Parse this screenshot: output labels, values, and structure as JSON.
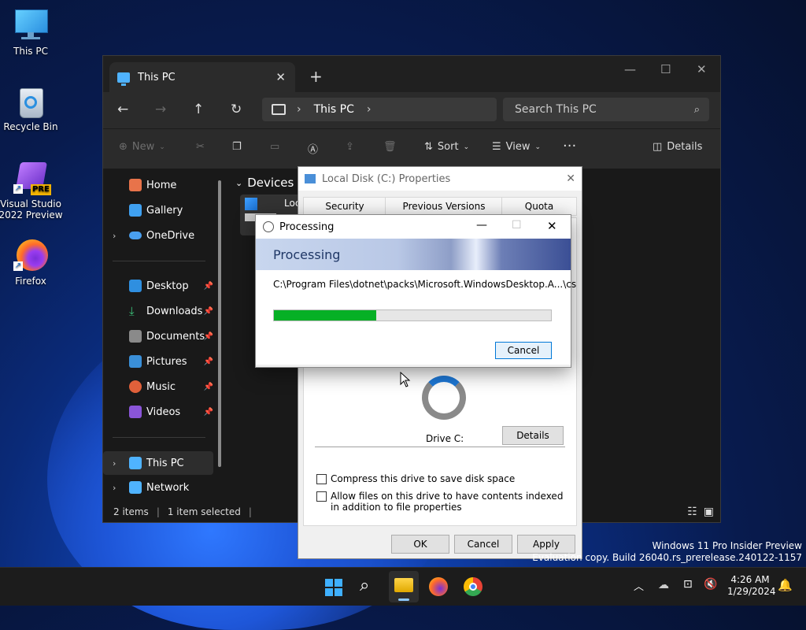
{
  "desktop": {
    "icons": [
      {
        "label": "This PC",
        "icon": "monitor-icon"
      },
      {
        "label": "Recycle Bin",
        "icon": "recycle-bin-icon"
      },
      {
        "label": "Visual Studio 2022 Preview",
        "badge": "PRE",
        "icon": "visual-studio-icon"
      },
      {
        "label": "Firefox",
        "icon": "firefox-icon"
      }
    ]
  },
  "explorer": {
    "tab_title": "This PC",
    "breadcrumb": [
      "This PC"
    ],
    "search_placeholder": "Search This PC",
    "toolbar": {
      "new_label": "New",
      "sort_label": "Sort",
      "view_label": "View",
      "details_label": "Details"
    },
    "sidebar": {
      "items": [
        {
          "label": "Home",
          "color": "#e8734a"
        },
        {
          "label": "Gallery",
          "color": "#3fa0f0"
        },
        {
          "label": "OneDrive",
          "color": "#4aa0f0"
        },
        {
          "label": "Desktop",
          "color": "#2f8fe0"
        },
        {
          "label": "Downloads",
          "color": "#3cc27a"
        },
        {
          "label": "Documents",
          "color": "#8a8a8a"
        },
        {
          "label": "Pictures",
          "color": "#3a8fd8"
        },
        {
          "label": "Music",
          "color": "#e0603a"
        },
        {
          "label": "Videos",
          "color": "#8a55d8"
        },
        {
          "label": "This PC",
          "color": "#4fb3ff"
        },
        {
          "label": "Network",
          "color": "#4fb3ff"
        }
      ]
    },
    "content_heading": "Devices ar",
    "drive_label_fragment": "Loc",
    "status": {
      "items": "2 items",
      "selected": "1 item selected"
    }
  },
  "properties_dialog": {
    "title": "Local Disk (C:) Properties",
    "tabs": [
      "Security",
      "Previous Versions",
      "Quota"
    ],
    "drive_caption": "Drive C:",
    "details_button": "Details",
    "compress_label": "Compress this drive to save disk space",
    "index_label": "Allow files on this drive to have contents indexed in addition to file properties",
    "ok_button": "OK",
    "cancel_button": "Cancel",
    "apply_button": "Apply"
  },
  "processing_dialog": {
    "title": "Processing",
    "heading": "Processing",
    "path": "C:\\Program Files\\dotnet\\packs\\Microsoft.WindowsDesktop.A...\\cs",
    "progress_percent": 37,
    "cancel_button": "Cancel"
  },
  "watermark": {
    "line1": "Windows 11 Pro Insider Preview",
    "line2": "Evaluation copy. Build 26040.rs_prerelease.240122-1157"
  },
  "taskbar": {
    "time": "4:26 AM",
    "date": "1/29/2024"
  },
  "colors": {
    "accent": "#0078d7",
    "progress_green": "#06b025",
    "explorer_bg": "#191919"
  }
}
